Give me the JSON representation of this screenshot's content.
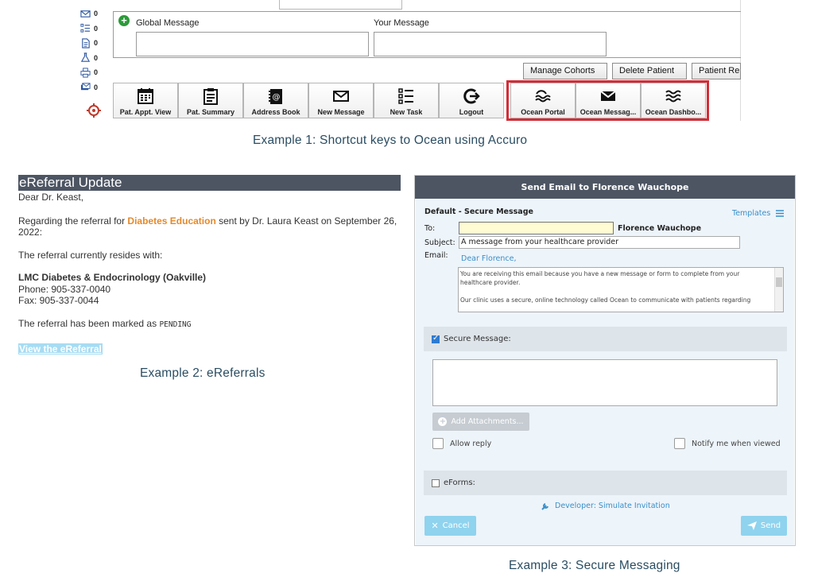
{
  "accuro": {
    "left_icon_counts": [
      "0",
      "0",
      "0",
      "0",
      "0",
      "0"
    ],
    "global_message_label": "Global Message",
    "your_message_label": "Your Message",
    "actions": [
      "Manage Cohorts",
      "Delete Patient",
      "Patient Re"
    ],
    "toolbar": [
      {
        "label": "Pat. Appt. View",
        "icon": "calendar-icon"
      },
      {
        "label": "Pat. Summary",
        "icon": "clipboard-icon"
      },
      {
        "label": "Address Book",
        "icon": "address-book-icon"
      },
      {
        "label": "New Message",
        "icon": "envelope-icon"
      },
      {
        "label": "New Task",
        "icon": "task-list-icon"
      },
      {
        "label": "Logout",
        "icon": "logout-icon"
      },
      {
        "label": "Ocean Portal",
        "icon": "ocean-waves-icon"
      },
      {
        "label": "Ocean Messag...",
        "icon": "envelope-icon"
      },
      {
        "label": "Ocean Dashbo...",
        "icon": "ocean-dashboard-icon"
      }
    ],
    "highlight_color": "#d32c36"
  },
  "captions": {
    "example1": "Example 1: Shortcut keys to Ocean using Accuro",
    "example2": "Example 2: eReferrals",
    "example3": "Example 3: Secure Messaging"
  },
  "ereferral": {
    "header": "eReferral Update",
    "greeting": "Dear Dr. Keast,",
    "regarding_prefix": "Regarding the referral for",
    "service": "Diabetes Education",
    "regarding_suffix": "sent by Dr. Laura Keast on September 26,",
    "regarding_line2": "2022:",
    "resides_text": "The referral currently resides with:",
    "clinic_name": "LMC Diabetes & Endocrinology (Oakville)",
    "phone": "Phone: 905-337-0040",
    "fax": "Fax: 905-337-0044",
    "status_prefix": "The referral has been marked as",
    "status": "PENDING",
    "link": "View the eReferral",
    "accent_color": "#e3892b"
  },
  "secure": {
    "title": "Send Email to Florence Wauchope",
    "section_title": "Default - Secure Message",
    "templates": "Templates",
    "to_label": "To:",
    "recipient": "Florence Wauchope",
    "subject_label": "Subject:",
    "subject_value": "A message from your healthcare provider",
    "email_label": "Email:",
    "greeting": "Dear Florence,",
    "email_line1": "You are receiving this email because you have a new message or form to complete from your",
    "email_line2": "healthcare provider.",
    "email_line3": "Our clinic uses a secure, online technology called Ocean to communicate with patients regarding",
    "secure_message_label": "Secure Message:",
    "add_attachments": "Add Attachments...",
    "allow_reply": "Allow reply",
    "notify_when_viewed": "Notify me when viewed",
    "eforms_label": "eForms:",
    "developer_link": "Developer: Simulate Invitation",
    "cancel": "Cancel",
    "send": "Send",
    "button_color": "#8fd3ee",
    "link_color": "#3a8fc8"
  }
}
